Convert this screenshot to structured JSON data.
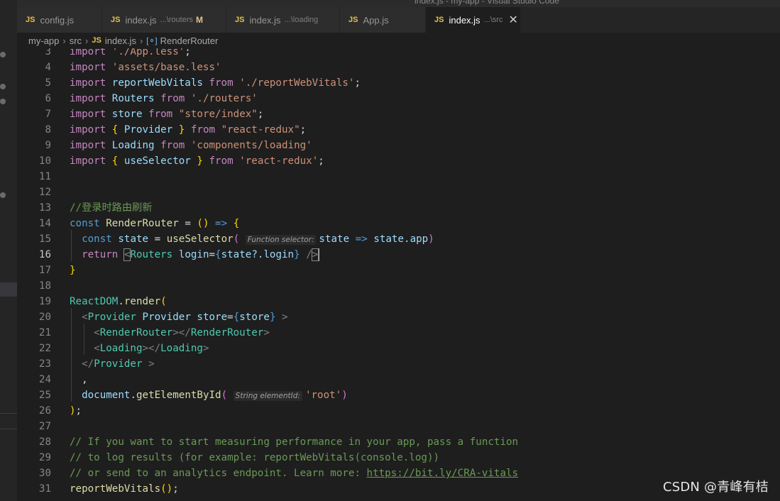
{
  "title_strip": "index.js - my-app - Visual Studio Code",
  "tabs": [
    {
      "name": "config.js",
      "desc": "",
      "modified": "",
      "active": false
    },
    {
      "name": "index.js",
      "desc": "...\\routers",
      "modified": "M",
      "active": false
    },
    {
      "name": "index.js",
      "desc": "...\\loading",
      "modified": "",
      "active": false
    },
    {
      "name": "App.js",
      "desc": "",
      "modified": "",
      "active": false
    },
    {
      "name": "index.js",
      "desc": "...\\src",
      "modified": "",
      "active": true
    }
  ],
  "tab_badge": "JS",
  "tab_close_icon": "✕",
  "breadcrumb": {
    "project": "my-app",
    "folder": "src",
    "file_badge": "JS",
    "file": "index.js",
    "symbol_icon": "[⚬]",
    "symbol": "RenderRouter",
    "separator": "›"
  },
  "editor": {
    "current_line": 16,
    "lines": [
      {
        "n": "3"
      },
      {
        "n": "4"
      },
      {
        "n": "5"
      },
      {
        "n": "6"
      },
      {
        "n": "7"
      },
      {
        "n": "8"
      },
      {
        "n": "9"
      },
      {
        "n": "10"
      },
      {
        "n": "11"
      },
      {
        "n": "12"
      },
      {
        "n": "13"
      },
      {
        "n": "14"
      },
      {
        "n": "15"
      },
      {
        "n": "16"
      },
      {
        "n": "17"
      },
      {
        "n": "18"
      },
      {
        "n": "19"
      },
      {
        "n": "20"
      },
      {
        "n": "21"
      },
      {
        "n": "22"
      },
      {
        "n": "23"
      },
      {
        "n": "24"
      },
      {
        "n": "25"
      },
      {
        "n": "26"
      },
      {
        "n": "27"
      },
      {
        "n": "28"
      },
      {
        "n": "29"
      },
      {
        "n": "30"
      },
      {
        "n": "31"
      }
    ],
    "code": {
      "l3_kw": "import",
      "l3_str": "'./App.less'",
      "l3_end": ";",
      "l4_kw": "import",
      "l4_str": "'assets/base.less'",
      "l5_kw": "import",
      "l5_id": "reportWebVitals",
      "l5_from": "from",
      "l5_str": "'./reportWebVitals'",
      "l5_end": ";",
      "l6_kw": "import",
      "l6_id": "Routers",
      "l6_from": "from",
      "l6_str": "'./routers'",
      "l7_kw": "import",
      "l7_id": "store",
      "l7_from": "from",
      "l7_str": "\"store/index\"",
      "l7_end": ";",
      "l8_kw": "import",
      "l8_open": "{",
      "l8_id": "Provider",
      "l8_close": "}",
      "l8_from": "from",
      "l8_str": "\"react-redux\"",
      "l8_end": ";",
      "l9_kw": "import",
      "l9_id": "Loading",
      "l9_from": "from",
      "l9_str": "'components/loading'",
      "l10_kw": "import",
      "l10_open": "{",
      "l10_id": "useSelector",
      "l10_close": "}",
      "l10_from": "from",
      "l10_str": "'react-redux'",
      "l10_end": ";",
      "l13_comment": "//登录时路由刷新",
      "l14_const": "const",
      "l14_id": "RenderRouter",
      "l14_eq": "=",
      "l14_parens": "()",
      "l14_arrow": "=>",
      "l14_brace": "{",
      "l15_const": "const",
      "l15_id": "state",
      "l15_eq": "=",
      "l15_fn": "useSelector",
      "l15_open": "(",
      "l15_hint": "Function selector:",
      "l15_param": "state",
      "l15_arrow": "=>",
      "l15_obj": "state",
      "l15_prop": ".app",
      "l15_close": ")",
      "l16_ret": "return",
      "l16_lt": "<",
      "l16_tag": "Routers",
      "l16_attr": "login",
      "l16_eq": "=",
      "l16_ob": "{",
      "l16_obj": "state",
      "l16_opt": "?.login",
      "l16_cb": "}",
      "l16_end": " /",
      "l16_gt": ">",
      "l17_brace": "}",
      "l19_obj": "ReactDOM",
      "l19_dot": ".",
      "l19_fn": "render",
      "l19_open": "(",
      "l20_lt": "<",
      "l20_tag": "Provider",
      "l20_tag2": "Provider",
      "l20_attr": "store",
      "l20_eq": "=",
      "l20_ob": "{",
      "l20_val": "store",
      "l20_cb": "}",
      "l20_gt": " >",
      "l21_open": "<",
      "l21_tag": "RenderRouter",
      "l21_mid": "></",
      "l21_tag2": "RenderRouter",
      "l21_gt": ">",
      "l22_open": "<",
      "l22_tag": "Loading",
      "l22_mid": "></",
      "l22_tag2": "Loading",
      "l22_gt": ">",
      "l23_open": "</",
      "l23_tag": "Provider",
      "l23_gt": " >",
      "l24_comma": ",",
      "l25_obj": "document",
      "l25_dot": ".",
      "l25_fn": "getElementById",
      "l25_open": "(",
      "l25_hint": "String elementId:",
      "l25_str": "'root'",
      "l25_close": ")",
      "l26_close": ")",
      "l26_end": ";",
      "l28_comment": "// If you want to start measuring performance in your app, pass a function",
      "l29_comment": "// to log results (for example: reportWebVitals(console.log))",
      "l30_comment": "// or send to an analytics endpoint. Learn more: ",
      "l30_link": "https://bit.ly/CRA-vitals",
      "l31_fn": "reportWebVitals",
      "l31_parens": "()",
      "l31_end": ";"
    }
  },
  "watermark": "CSDN @青峰有桔",
  "colors": {
    "background": "#1e1e1e",
    "keyword": "#c586c0",
    "string": "#ce9178",
    "variable": "#9cdcfe",
    "function": "#dcdcaa",
    "comment": "#6a9955",
    "storage": "#569cd6",
    "tag": "#4ec9b0",
    "js_badge": "#e8c04a"
  }
}
